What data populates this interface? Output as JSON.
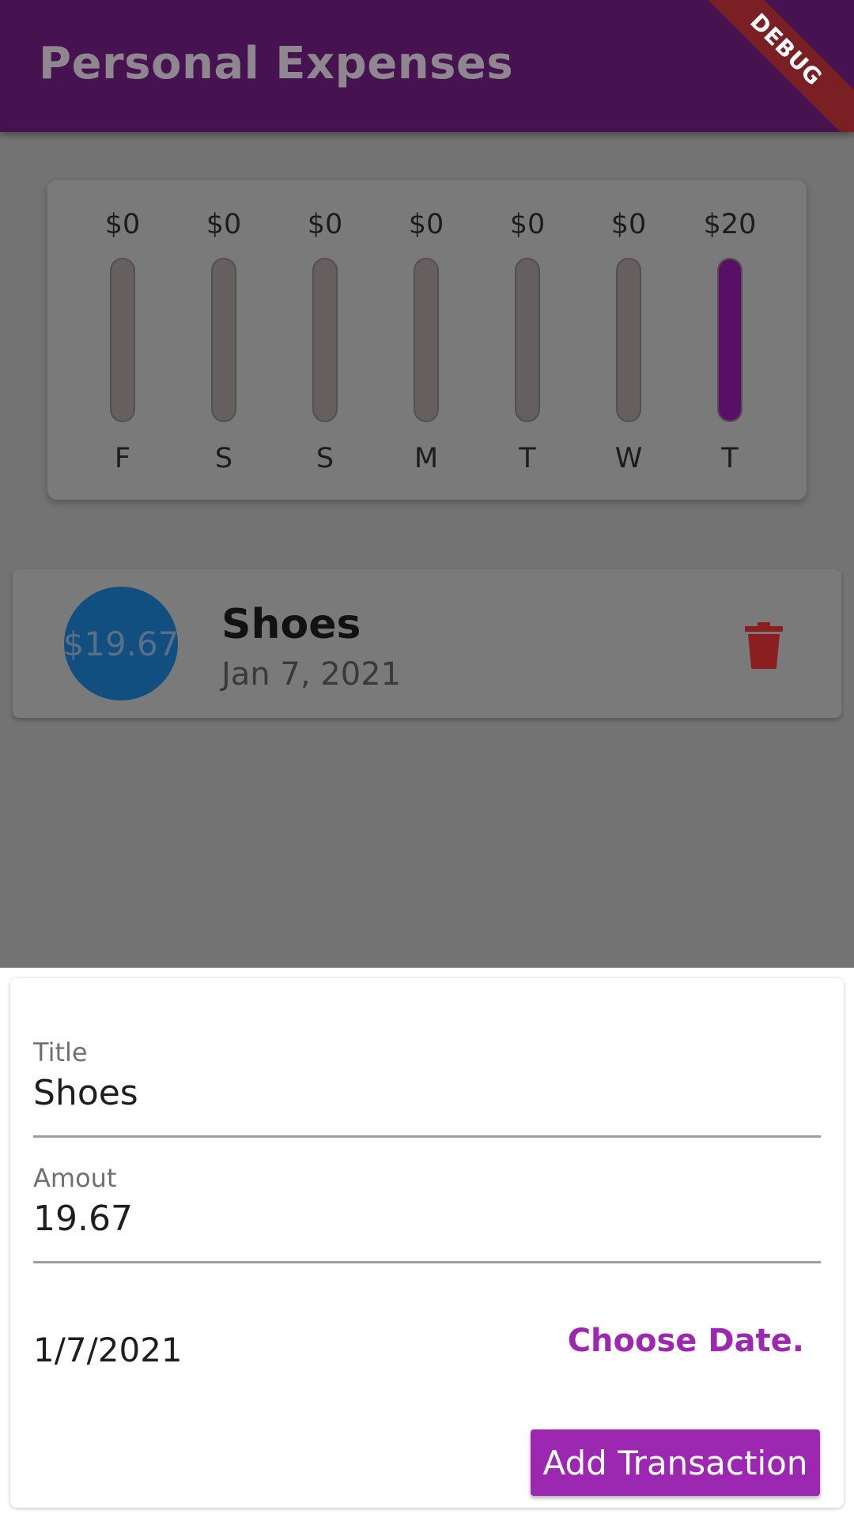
{
  "app_bar": {
    "title": "Personal Expenses",
    "debug_banner": "DEBUG"
  },
  "chart_data": {
    "type": "bar",
    "categories": [
      "F",
      "S",
      "S",
      "M",
      "T",
      "W",
      "T"
    ],
    "values": [
      0,
      0,
      0,
      0,
      0,
      0,
      20
    ],
    "value_labels": [
      "$0",
      "$0",
      "$0",
      "$0",
      "$0",
      "$0",
      "$20"
    ],
    "fill_fraction": [
      0,
      0,
      0,
      0,
      0,
      0,
      1
    ],
    "title": "",
    "xlabel": "",
    "ylabel": "",
    "fill_color": "#5a0f66",
    "track_color": "#665f5f"
  },
  "transactions": [
    {
      "amount": "$19.67",
      "title": "Shoes",
      "date": "Jan 7, 2021",
      "delete_icon": "trash-icon",
      "avatar_color": "#114f80",
      "delete_color": "#8b1e1e"
    }
  ],
  "form": {
    "title_label": "Title",
    "title_value": "Shoes",
    "amount_label": "Amout",
    "amount_value": "19.67",
    "date_value": "1/7/2021",
    "choose_date_label": "Choose Date.",
    "submit_label": "Add Transaction",
    "accent_color": "#9c27b0"
  }
}
